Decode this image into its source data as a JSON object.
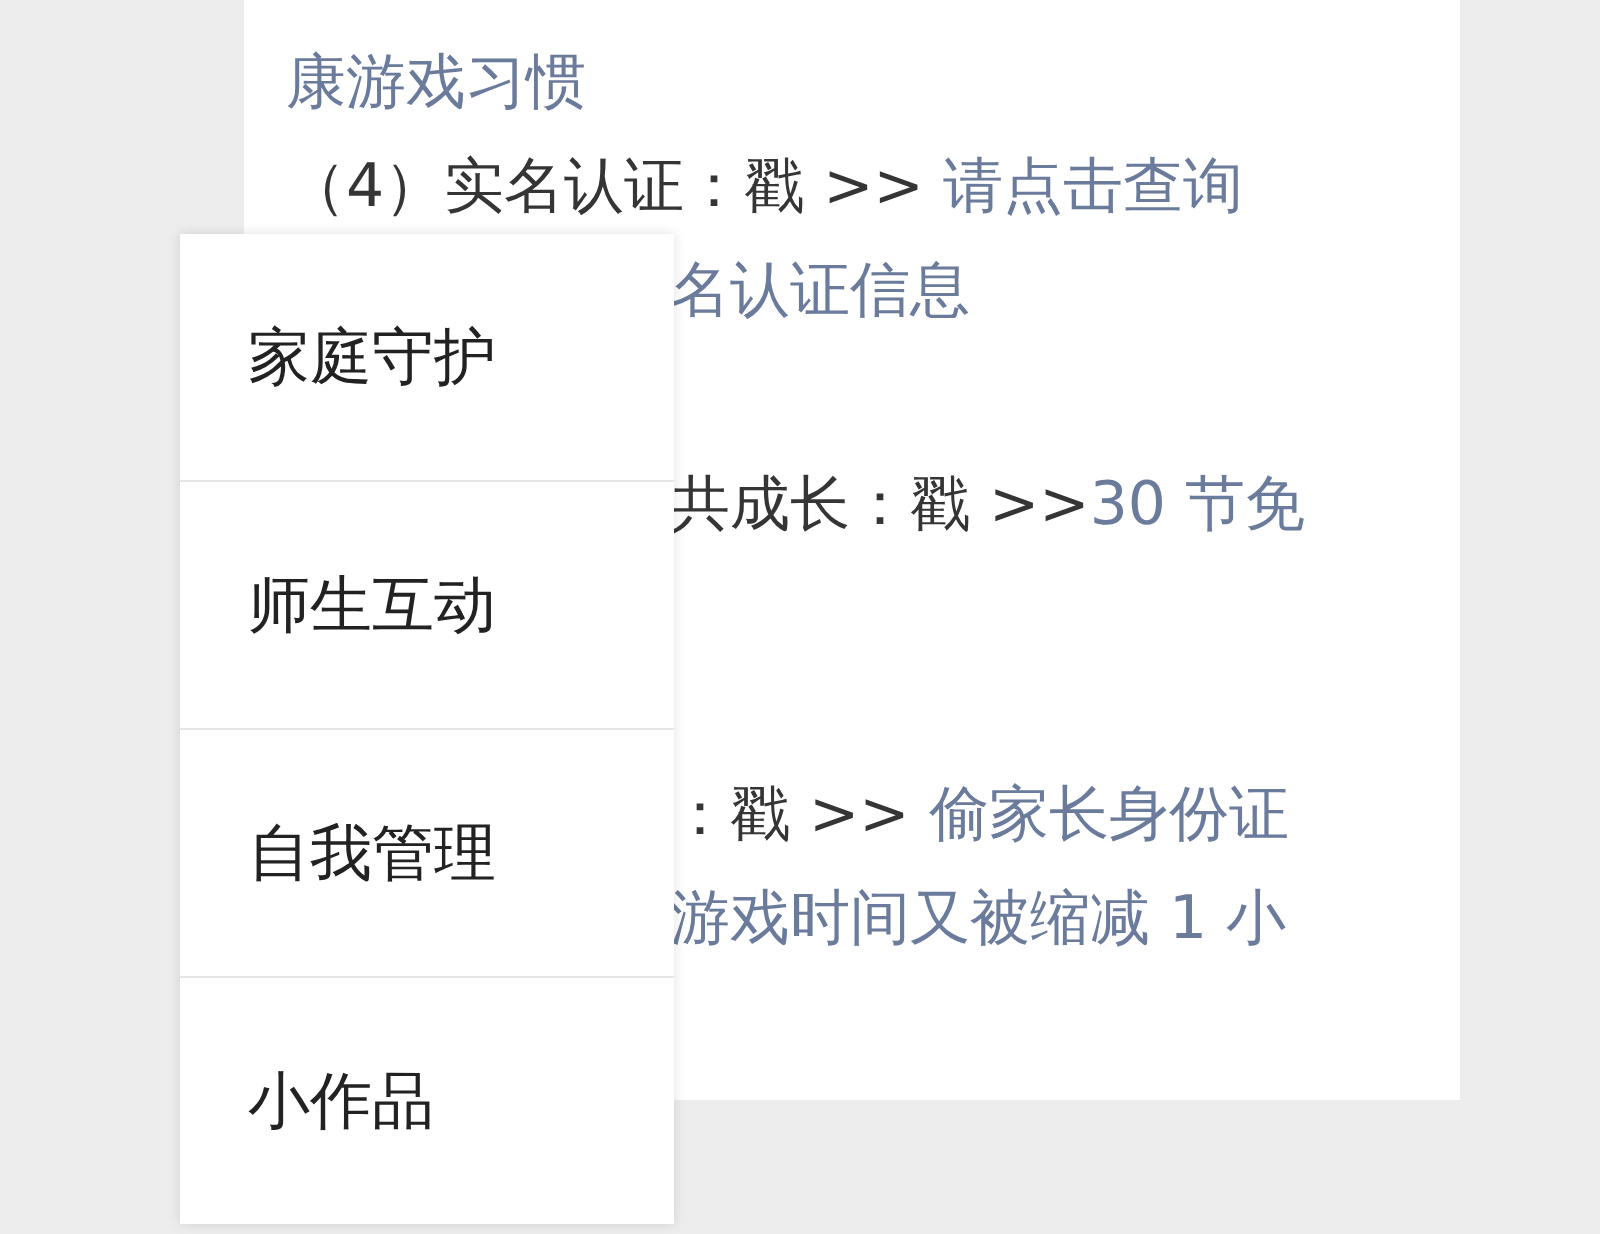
{
  "article": {
    "paragraphs": [
      {
        "lines": [
          {
            "clipped": false,
            "segments": [
              {
                "text": "康游戏习惯",
                "link": true
              }
            ]
          },
          {
            "clipped": false,
            "segments": [
              {
                "text": "（4）实名认证：戳 >> ",
                "link": false
              },
              {
                "text": "请点击查询",
                "link": true
              }
            ]
          },
          {
            "clipped": true,
            "segments": [
              {
                "text": "名认证信息",
                "link": true
              }
            ]
          }
        ]
      },
      {
        "lines": [
          {
            "clipped": true,
            "segments": [
              {
                "text": "共成长：戳 >>",
                "link": false
              },
              {
                "text": "30 节免",
                "link": true
              }
            ]
          }
        ]
      },
      {
        "lines": [
          {
            "clipped": true,
            "segments": [
              {
                "text": "：戳 >> ",
                "link": false
              },
              {
                "text": "偷家长身份证",
                "link": true
              }
            ]
          },
          {
            "clipped": true,
            "segments": [
              {
                "text": "游戏时间又被缩减 1 小",
                "link": true
              }
            ]
          }
        ]
      }
    ]
  },
  "menu": {
    "items": [
      {
        "label": "家庭守护"
      },
      {
        "label": "师生互动"
      },
      {
        "label": "自我管理"
      },
      {
        "label": "小作品"
      }
    ]
  }
}
